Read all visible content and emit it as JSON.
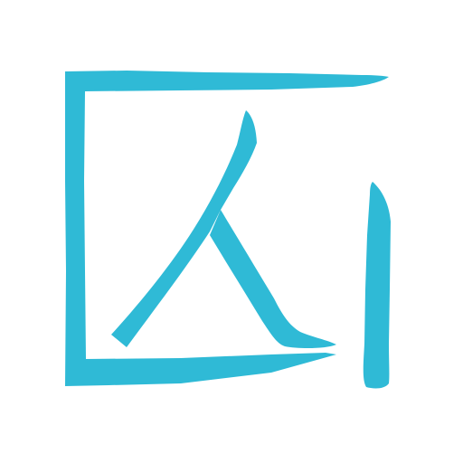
{
  "logo": {
    "name": "brush-frame-person-logo",
    "icon": "brush-square-frame-with-ren-character",
    "glyph": "人"
  },
  "colors": {
    "stroke": "#2fbad6",
    "background": "#ffffff"
  }
}
